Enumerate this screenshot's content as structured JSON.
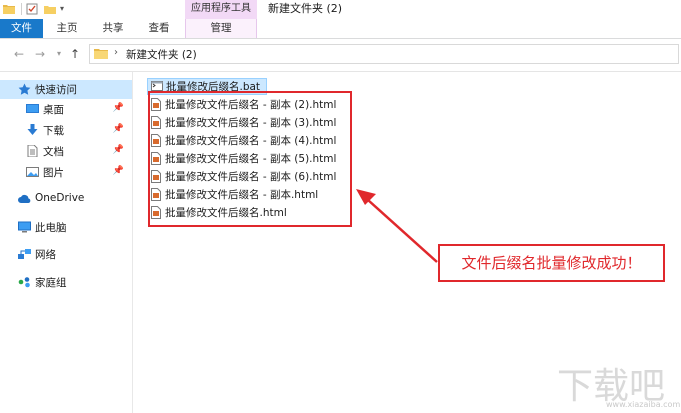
{
  "window": {
    "title": "新建文件夹 (2)"
  },
  "ribbon": {
    "context_group": "应用程序工具",
    "tabs": [
      {
        "label": "文件"
      },
      {
        "label": "主页"
      },
      {
        "label": "共享"
      },
      {
        "label": "查看"
      },
      {
        "label": "管理"
      }
    ]
  },
  "address": {
    "path": "新建文件夹 (2)"
  },
  "nav": {
    "items": [
      {
        "label": "快速访问",
        "icon": "star-icon"
      },
      {
        "label": "桌面",
        "icon": "desktop-icon"
      },
      {
        "label": "下载",
        "icon": "download-icon"
      },
      {
        "label": "文档",
        "icon": "document-icon"
      },
      {
        "label": "图片",
        "icon": "picture-icon"
      },
      {
        "label": "OneDrive",
        "icon": "cloud-icon"
      },
      {
        "label": "此电脑",
        "icon": "computer-icon"
      },
      {
        "label": "网络",
        "icon": "network-icon"
      },
      {
        "label": "家庭组",
        "icon": "homegroup-icon"
      }
    ]
  },
  "files": [
    {
      "name": "批量修改后缀名.bat",
      "type": "bat"
    },
    {
      "name": "批量修改文件后缀名 - 副本 (2).html",
      "type": "html"
    },
    {
      "name": "批量修改文件后缀名 - 副本 (3).html",
      "type": "html"
    },
    {
      "name": "批量修改文件后缀名 - 副本 (4).html",
      "type": "html"
    },
    {
      "name": "批量修改文件后缀名 - 副本 (5).html",
      "type": "html"
    },
    {
      "name": "批量修改文件后缀名 - 副本 (6).html",
      "type": "html"
    },
    {
      "name": "批量修改文件后缀名 - 副本.html",
      "type": "html"
    },
    {
      "name": "批量修改文件后缀名.html",
      "type": "html"
    }
  ],
  "annotation": {
    "text": "文件后缀名批量修改成功！",
    "color": "#e0282c"
  },
  "watermark": {
    "text": "下载吧",
    "subtext": "www.xiazaiba.com"
  },
  "colors": {
    "accent": "#1979ca",
    "selection": "#cce8ff",
    "context_tab": "#f2d9f6"
  }
}
